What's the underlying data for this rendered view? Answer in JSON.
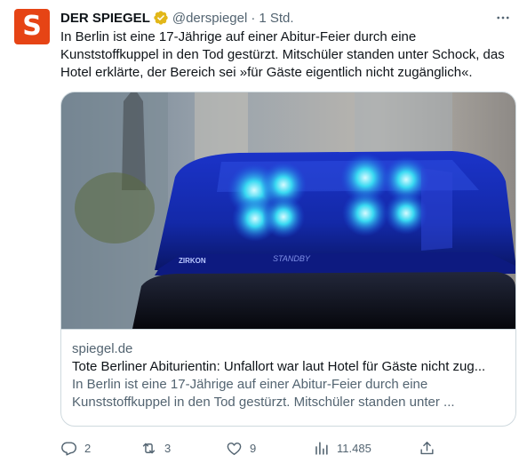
{
  "author": {
    "name": "DER SPIEGEL",
    "handle": "@derspiegel",
    "separator": "·",
    "time": "1 Std.",
    "avatar_letter": "S",
    "avatar_color": "#e64415"
  },
  "tweet_text": "In Berlin ist eine 17-Jährige auf einer Abitur-Feier durch eine Kunststoffkuppel in den Tod gestürzt. Mitschüler standen unter Schock, das Hotel erklärte, der Bereich sei »für Gäste eigentlich nicht zugänglich«.",
  "card": {
    "domain": "spiegel.de",
    "title": "Tote Berliner Abiturientin: Unfallort war laut Hotel für Gäste nicht zug...",
    "description": "In Berlin ist eine 17-Jährige auf einer Abitur-Feier durch eine Kunststoffkuppel in den Tod gestürzt. Mitschüler standen unter ...",
    "image_text_left": "ZIRKON",
    "image_text_center": "STANDBY"
  },
  "actions": {
    "replies": "2",
    "retweets": "3",
    "likes": "9",
    "views": "11.485"
  },
  "icons": [
    "verified-badge-icon",
    "more-icon",
    "reply-icon",
    "retweet-icon",
    "like-icon",
    "views-icon",
    "share-icon"
  ],
  "colors": {
    "accent_gold": "#e2b719",
    "muted": "#536471",
    "border": "#cfd9de"
  }
}
